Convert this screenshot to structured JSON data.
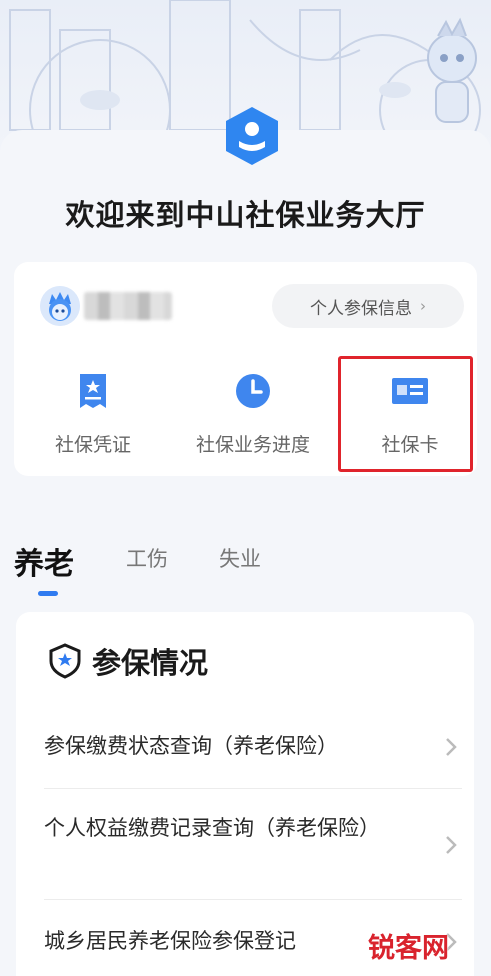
{
  "page_title": "欢迎来到中山社保业务大厅",
  "user": {
    "info_button_label": "个人参保信息",
    "info_button_chevron": "›"
  },
  "quick_actions": [
    {
      "label": "社保凭证",
      "icon": "certificate-icon"
    },
    {
      "label": "社保业务进度",
      "icon": "clock-icon"
    },
    {
      "label": "社保卡",
      "icon": "social-security-card-icon"
    }
  ],
  "tabs": [
    {
      "label": "养老",
      "active": true
    },
    {
      "label": "工伤",
      "active": false
    },
    {
      "label": "失业",
      "active": false
    }
  ],
  "section": {
    "title": "参保情况",
    "icon": "shield-star-icon",
    "rows": [
      {
        "label": "参保缴费状态查询（养老保险）"
      },
      {
        "label": "个人权益缴费记录查询（养老保险）"
      },
      {
        "label": "城乡居民养老保险参保登记"
      }
    ]
  },
  "watermark": "锐客网",
  "colors": {
    "accent": "#2f7bf0",
    "highlight": "#e0242c",
    "logo": "#2f86f0"
  }
}
